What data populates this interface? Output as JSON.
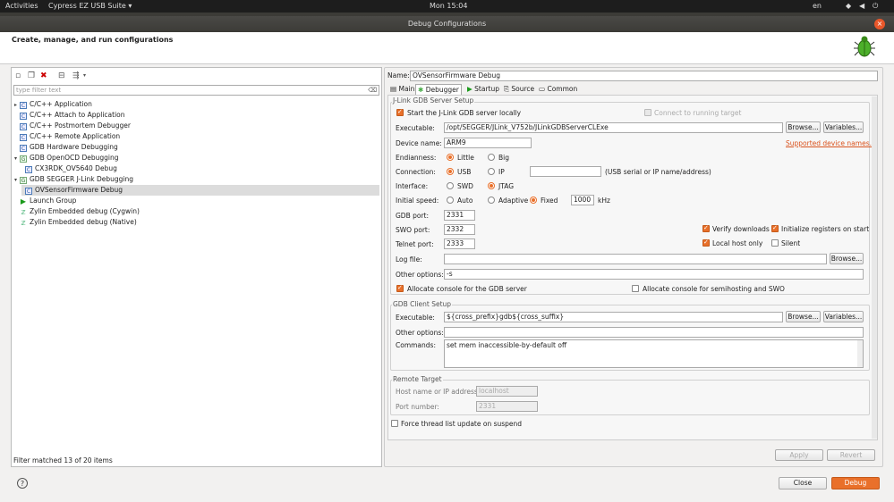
{
  "topbar": {
    "activities": "Activities",
    "app_menu": "Cypress EZ USB Suite",
    "clock": "Mon 15:04",
    "lang": "en"
  },
  "window": {
    "title": "Debug Configurations",
    "close": "×"
  },
  "header": {
    "title": "Create, manage, and run configurations"
  },
  "left": {
    "filter_placeholder": "type filter text",
    "tree": [
      {
        "label": "C/C++ Application",
        "icon": "c"
      },
      {
        "label": "C/C++ Attach to Application",
        "icon": "c"
      },
      {
        "label": "C/C++ Postmortem Debugger",
        "icon": "c"
      },
      {
        "label": "C/C++ Remote Application",
        "icon": "c"
      },
      {
        "label": "GDB Hardware Debugging",
        "icon": "c"
      },
      {
        "label": "GDB OpenOCD Debugging",
        "icon": "g"
      },
      {
        "label": "CX3RDK_OV5640 Debug",
        "icon": "c"
      },
      {
        "label": "GDB SEGGER J-Link Debugging",
        "icon": "g"
      },
      {
        "label": "OVSensorFirmware Debug",
        "icon": "c"
      },
      {
        "label": "Launch Group",
        "icon": "run"
      },
      {
        "label": "Zylin Embedded debug (Cygwin)",
        "icon": "z"
      },
      {
        "label": "Zylin Embedded debug (Native)",
        "icon": "z"
      }
    ],
    "status": "Filter matched 13 of 20 items"
  },
  "right": {
    "name_label": "Name:",
    "name_value": "OVSensorFirmware Debug",
    "tabs": [
      "Main",
      "Debugger",
      "Startup",
      "Source",
      "Common"
    ],
    "jlink": {
      "group_title": "J-Link GDB Server Setup",
      "start_server": "Start the J-Link GDB server locally",
      "connect_running": "Connect to running target",
      "executable_label": "Executable:",
      "executable_value": "/opt/SEGGER/JLink_V752b/JLinkGDBServerCLExe",
      "browse": "Browse...",
      "variables": "Variables...",
      "device_label": "Device name:",
      "device_value": "ARM9",
      "supported": "Supported device names.",
      "endian_label": "Endianness:",
      "little": "Little",
      "big": "Big",
      "connection_label": "Connection:",
      "usb": "USB",
      "ip": "IP",
      "usb_hint": "(USB serial or IP name/address)",
      "interface_label": "Interface:",
      "swd": "SWD",
      "jtag": "JTAG",
      "speed_label": "Initial speed:",
      "auto": "Auto",
      "adaptive": "Adaptive",
      "fixed": "Fixed",
      "speed_value": "1000",
      "khz": "kHz",
      "gdbport_label": "GDB port:",
      "gdbport_value": "2331",
      "swoport_label": "SWO port:",
      "swoport_value": "2332",
      "telnet_label": "Telnet port:",
      "telnet_value": "2333",
      "verify": "Verify downloads",
      "init_regs": "Initialize registers on start",
      "localhost": "Local host only",
      "silent": "Silent",
      "log_label": "Log file:",
      "log_value": "",
      "other_label": "Other options:",
      "other_value": "-s",
      "alloc_console": "Allocate console for the GDB server",
      "alloc_semi": "Allocate console for semihosting and SWO"
    },
    "client": {
      "group_title": "GDB Client Setup",
      "executable_label": "Executable:",
      "executable_value": "${cross_prefix}gdb${cross_suffix}",
      "browse": "Browse...",
      "variables": "Variables...",
      "other_label": "Other options:",
      "other_value": "",
      "commands_label": "Commands:",
      "commands_value": "set mem inaccessible-by-default off"
    },
    "remote": {
      "group_title": "Remote Target",
      "host_label": "Host name or IP address:",
      "host_value": "localhost",
      "port_label": "Port number:",
      "port_value": "2331"
    },
    "force_thread": "Force thread list update on suspend",
    "apply": "Apply",
    "revert": "Revert"
  },
  "footer": {
    "help": "?",
    "close": "Close",
    "debug": "Debug"
  }
}
